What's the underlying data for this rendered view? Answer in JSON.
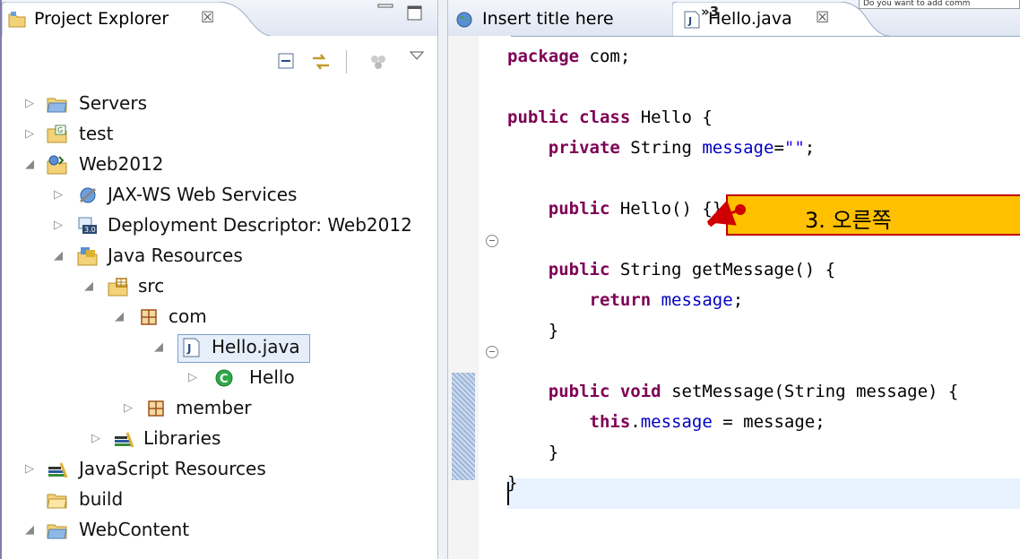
{
  "left_panel": {
    "tab_label": "Project Explorer",
    "tab_close": "☒"
  },
  "tree": [
    {
      "label": "Servers",
      "expander": "▷",
      "icon": "folder-icon"
    },
    {
      "label": "test",
      "expander": "▷",
      "icon": "project-icon"
    },
    {
      "label": "Web2012",
      "expander": "◢",
      "icon": "web-project-icon"
    },
    {
      "label": "JAX-WS Web Services",
      "expander": "▷",
      "icon": "web-services-icon"
    },
    {
      "label": "Deployment Descriptor: Web2012",
      "expander": "▷",
      "icon": "deployment-descriptor-icon",
      "badge": "3.0"
    },
    {
      "label": "Java Resources",
      "expander": "◢",
      "icon": "java-resources-icon"
    },
    {
      "label": "src",
      "expander": "◢",
      "icon": "source-folder-icon"
    },
    {
      "label": "com",
      "expander": "◢",
      "icon": "package-icon"
    },
    {
      "label": "Hello.java",
      "expander": "◢",
      "icon": "java-file-icon",
      "selected": true
    },
    {
      "label": "Hello",
      "expander": "▷",
      "icon": "class-icon"
    },
    {
      "label": "member",
      "expander": "▷",
      "icon": "package-icon"
    },
    {
      "label": "Libraries",
      "expander": "▷",
      "icon": "libraries-icon"
    },
    {
      "label": "JavaScript Resources",
      "expander": "▷",
      "icon": "libraries-icon"
    },
    {
      "label": "build",
      "expander": "",
      "icon": "folder-icon"
    },
    {
      "label": "WebContent",
      "expander": "◢",
      "icon": "folder-icon"
    }
  ],
  "editor": {
    "tabs": [
      {
        "label": "Insert title here",
        "icon": "globe-icon"
      },
      {
        "label": "Hello.java",
        "icon": "java-file-icon",
        "close": "☒",
        "active": true
      }
    ],
    "overflow": "»3",
    "notification": "Do you want to add comm",
    "code_lines": [
      "package com;",
      "",
      "public class Hello {",
      "    private String message=\"\";",
      "",
      "    public Hello() {}",
      "",
      "    public String getMessage() {",
      "        return message;",
      "    }",
      "",
      "    public void setMessage(String message) {",
      "        this.message = message;",
      "    }",
      "}"
    ]
  },
  "callout": {
    "text": "3. 오른쪽"
  },
  "colors": {
    "keyword": "#7f0055",
    "field": "#0000c0",
    "string": "#2a00ff",
    "callout_fill": "#ffc000",
    "callout_border": "#c00000",
    "selection": "#e6eefa"
  }
}
